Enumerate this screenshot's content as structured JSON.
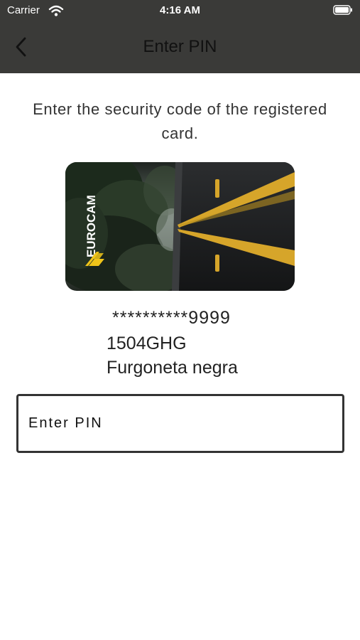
{
  "status_bar": {
    "carrier": "Carrier",
    "time": "4:16 AM",
    "wifi_icon": "wifi-icon",
    "battery_icon": "battery-icon"
  },
  "nav": {
    "title": "Enter PIN",
    "back_icon": "chevron-left-icon"
  },
  "instructions": "Enter the security code of the registered card.",
  "card": {
    "brand": "EUROCAM",
    "number_masked": "**********9999",
    "plate": "1504GHG",
    "description": "Furgoneta negra",
    "brand_color": "#f0c419"
  },
  "pin_input": {
    "placeholder": "Enter PIN",
    "value": ""
  },
  "colors": {
    "header_bg": "#3a3a38",
    "accent": "#f0c419",
    "text": "#333333"
  }
}
